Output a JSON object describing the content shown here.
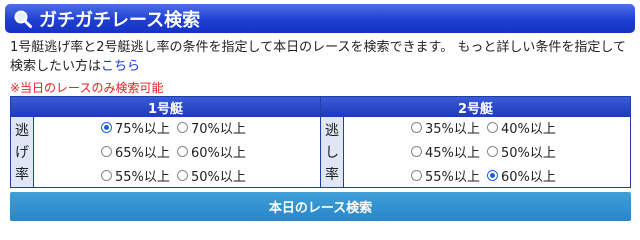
{
  "header": {
    "title": "ガチガチレース検索",
    "icon": "search-icon"
  },
  "intro": {
    "text": "1号艇逃げ率と2号艇逃し率の条件を指定して本日のレースを検索できます。 もっと詳しい条件を指定して検索したい方は",
    "link_label": "こちら"
  },
  "notice": "※当日のレースのみ検索可能",
  "panels": [
    {
      "heading": "1号艇",
      "side_label": [
        "逃",
        "げ",
        "率"
      ],
      "options": [
        {
          "label": "75%以上",
          "selected": true
        },
        {
          "label": "70%以上",
          "selected": false
        },
        {
          "label": "65%以上",
          "selected": false
        },
        {
          "label": "60%以上",
          "selected": false
        },
        {
          "label": "55%以上",
          "selected": false
        },
        {
          "label": "50%以上",
          "selected": false
        }
      ]
    },
    {
      "heading": "2号艇",
      "side_label": [
        "逃",
        "し",
        "率"
      ],
      "options": [
        {
          "label": "35%以上",
          "selected": false
        },
        {
          "label": "40%以上",
          "selected": false
        },
        {
          "label": "45%以上",
          "selected": false
        },
        {
          "label": "50%以上",
          "selected": false
        },
        {
          "label": "55%以上",
          "selected": false
        },
        {
          "label": "60%以上",
          "selected": true
        }
      ]
    }
  ],
  "search_button": "本日のレース検索",
  "colors": {
    "title_bar": "#1f3fd4",
    "panel_border": "#1e3ea8",
    "button": "#2a86c8",
    "notice": "#e32222",
    "link": "#1a33dd"
  }
}
